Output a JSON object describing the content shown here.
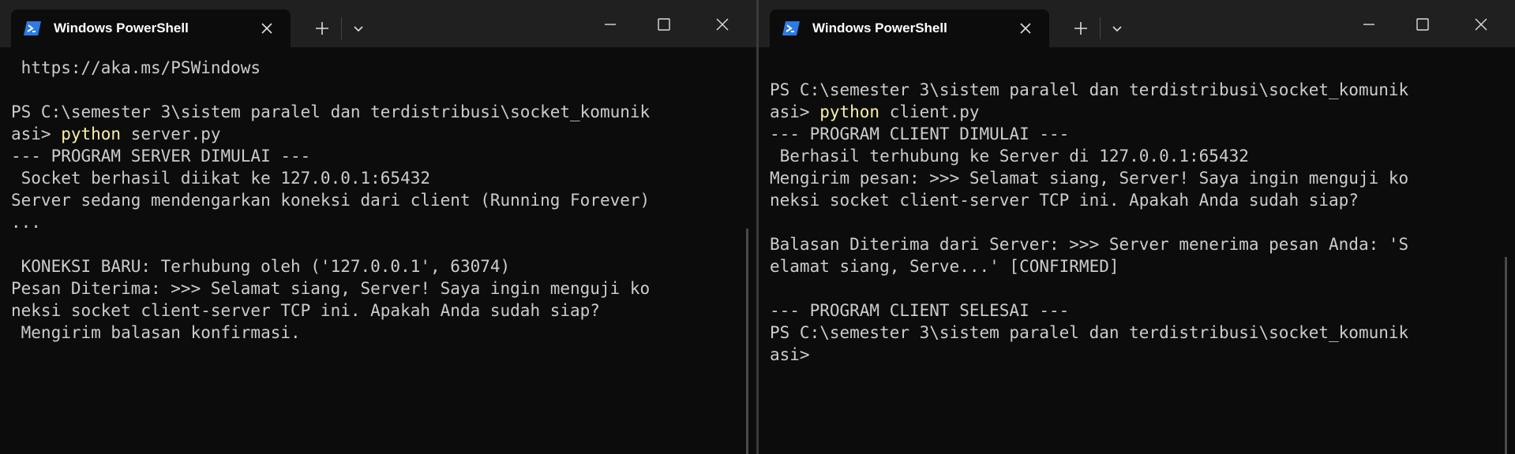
{
  "colors": {
    "terminal_bg": "#0c0c0c",
    "text": "#cccccc",
    "command_highlight": "#f9f1a5",
    "titlebar": "#202020",
    "icon_blue": "#2c7be5"
  },
  "left": {
    "tab_title": "Windows PowerShell",
    "lines": [
      " https://aka.ms/PSWindows",
      "",
      "PS C:\\semester 3\\sistem paralel dan terdistribusi\\socket_komunik",
      "asi> ",
      "--- PROGRAM SERVER DIMULAI ---",
      " Socket berhasil diikat ke 127.0.0.1:65432",
      "Server sedang mendengarkan koneksi dari client (Running Forever)",
      "...",
      "",
      " KONEKSI BARU: Terhubung oleh ('127.0.0.1', 63074)",
      "Pesan Diterima: >>> Selamat siang, Server! Saya ingin menguji ko",
      "neksi socket client-server TCP ini. Apakah Anda sudah siap?",
      " Mengirim balasan konfirmasi."
    ],
    "command": "python",
    "command_args": " server.py"
  },
  "right": {
    "tab_title": "Windows PowerShell",
    "lines": [
      "",
      "PS C:\\semester 3\\sistem paralel dan terdistribusi\\socket_komunik",
      "asi> ",
      "--- PROGRAM CLIENT DIMULAI ---",
      " Berhasil terhubung ke Server di 127.0.0.1:65432",
      "Mengirim pesan: >>> Selamat siang, Server! Saya ingin menguji ko",
      "neksi socket client-server TCP ini. Apakah Anda sudah siap?",
      "",
      "Balasan Diterima dari Server: >>> Server menerima pesan Anda: 'S",
      "elamat siang, Serve...' [CONFIRMED]",
      "",
      "--- PROGRAM CLIENT SELESAI ---",
      "PS C:\\semester 3\\sistem paralel dan terdistribusi\\socket_komunik",
      "asi>"
    ],
    "command": "python",
    "command_args": " client.py"
  },
  "icons": {
    "tab_icon": "powershell-icon",
    "close_tab": "close-icon",
    "new_tab": "plus-icon",
    "dropdown": "chevron-down-icon",
    "minimize": "minimize-icon",
    "maximize": "maximize-icon",
    "close_window": "close-icon"
  }
}
